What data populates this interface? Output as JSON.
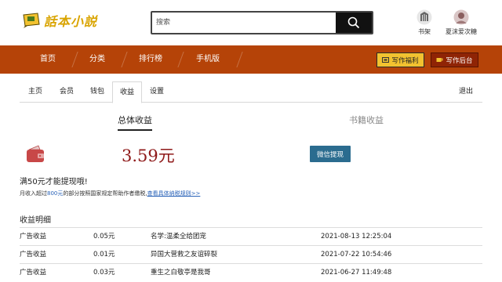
{
  "header": {
    "logo_text": "話本小説",
    "search_placeholder": "搜索",
    "shelf_label": "书架",
    "username": "夏沫爱次糖"
  },
  "nav": {
    "items": [
      "首页",
      "分类",
      "排行榜",
      "手机版"
    ],
    "welfare_label": "写作福利",
    "backend_label": "写作后台"
  },
  "tabs": {
    "items": [
      "主页",
      "会员",
      "钱包",
      "收益",
      "设置"
    ],
    "active": "收益",
    "logout": "退出"
  },
  "income": {
    "total_tab": "总体收益",
    "books_tab": "书籍收益",
    "amount": "3.59元",
    "withdraw_label": "微信提现",
    "notice_min": "满50元才能提现哦!",
    "notice_tax_prefix": "月收入超过",
    "notice_tax_amount": "800元",
    "notice_tax_mid": "的部分按照国家规定帮助作者缴税,",
    "notice_tax_link": "查看具体纳税规则>>"
  },
  "details": {
    "title": "收益明细",
    "rows": [
      {
        "type": "广告收益",
        "amount": "0.05元",
        "book": "名学:温柔全给团宠",
        "time": "2021-08-13 12:25:04"
      },
      {
        "type": "广告收益",
        "amount": "0.01元",
        "book": "异国大营救之友谊碎裂",
        "time": "2021-07-22 10:54:46"
      },
      {
        "type": "广告收益",
        "amount": "0.03元",
        "book": "重生之白敬亭是我哥",
        "time": "2021-06-27 11:49:48"
      }
    ]
  },
  "colors": {
    "nav_bg": "#b54308",
    "amount": "#8f1a1a",
    "withdraw_btn": "#2b6c8f",
    "welfare_btn": "#f2c230",
    "backend_btn": "#8f2405"
  }
}
